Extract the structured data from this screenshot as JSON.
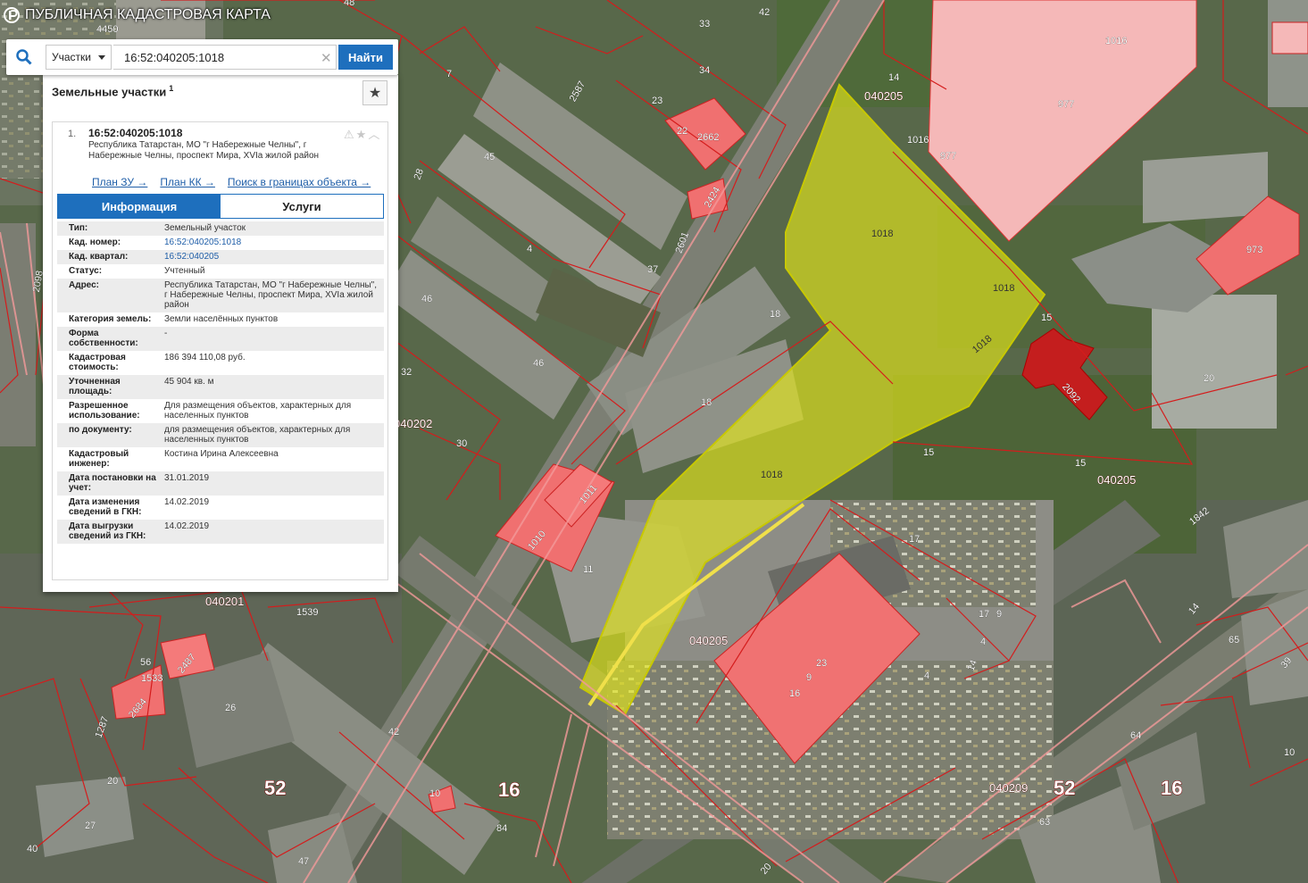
{
  "app": {
    "title": "ПУБЛИЧНАЯ КАДАСТРОВАЯ КАРТА"
  },
  "search": {
    "type_selected": "Участки",
    "query": "16:52:040205:1018",
    "find_label": "Найти"
  },
  "panel": {
    "title": "Земельные участки",
    "count": "1",
    "card": {
      "index": "1.",
      "cadnum": "16:52:040205:1018",
      "address": "Республика Татарстан, МО \"г Набережные Челны\", г Набережные Челны, проспект Мира, XVIa жилой район",
      "links": [
        "План ЗУ →",
        "План КК →",
        "Поиск в границах объекта →"
      ],
      "tabs": [
        "Информация",
        "Услуги"
      ],
      "rows": [
        {
          "key": "Тип:",
          "value": "Земельный участок"
        },
        {
          "key": "Кад. номер:",
          "value": "16:52:040205:1018",
          "link": true
        },
        {
          "key": "Кад. квартал:",
          "value": "16:52:040205",
          "link": true
        },
        {
          "key": "Статус:",
          "value": "Учтенный"
        },
        {
          "key": "Адрес:",
          "value": "Республика Татарстан, МО \"г Набережные Челны\", г Набережные Челны, проспект Мира, XVIa жилой район"
        },
        {
          "key": "Категория земель:",
          "value": "Земли населённых пунктов"
        },
        {
          "key": "Форма собственности:",
          "value": "-"
        },
        {
          "key": "Кадастровая стоимость:",
          "value": "186 394 110,08 руб."
        },
        {
          "key": "Уточненная площадь:",
          "value": "45 904 кв. м"
        },
        {
          "key": "Разрешенное использование:",
          "value": "Для размещения объектов, характерных для населенных пунктов"
        },
        {
          "key": "по документу:",
          "value": "для размещения объектов, характерных для населенных пунктов"
        },
        {
          "key": "Кадастровый инженер:",
          "value": "Костина Ирина Алексеевна"
        },
        {
          "key": "Дата постановки на учет:",
          "value": "31.01.2019"
        },
        {
          "key": "Дата изменения сведений в ГКН:",
          "value": "14.02.2019"
        },
        {
          "key": "Дата выгрузки сведений из ГКН:",
          "value": "14.02.2019"
        }
      ]
    }
  },
  "map": {
    "selected_parcel": "1018",
    "selected_color": "#e4e61a",
    "parcel_labels": [
      "4450",
      "48",
      "42",
      "33",
      "34",
      "7",
      "23",
      "22",
      "2662",
      "2424",
      "2601",
      "37",
      "45",
      "28",
      "4",
      "46",
      "46",
      "32",
      "18",
      "18",
      "30",
      "1016",
      "977",
      "977",
      "1016",
      "14",
      "15",
      "973",
      "2092",
      "20",
      "15",
      "15",
      "17",
      "17",
      "9",
      "4",
      "14",
      "4",
      "9",
      "23",
      "16",
      "11",
      "1010",
      "1011",
      "1539",
      "2487",
      "1533",
      "56",
      "2684",
      "26",
      "42",
      "1287",
      "20",
      "10",
      "52",
      "16",
      "27",
      "84",
      "47",
      "40209",
      "52",
      "16",
      "63",
      "64",
      "10",
      "65",
      "39",
      "14",
      "1842",
      "2098",
      "2587",
      "20",
      "40"
    ],
    "block_labels": [
      "040205",
      "040202",
      "040201",
      "040205",
      "040205",
      "040209"
    ],
    "big_labels": [
      "52",
      "16",
      "52",
      "16"
    ]
  }
}
